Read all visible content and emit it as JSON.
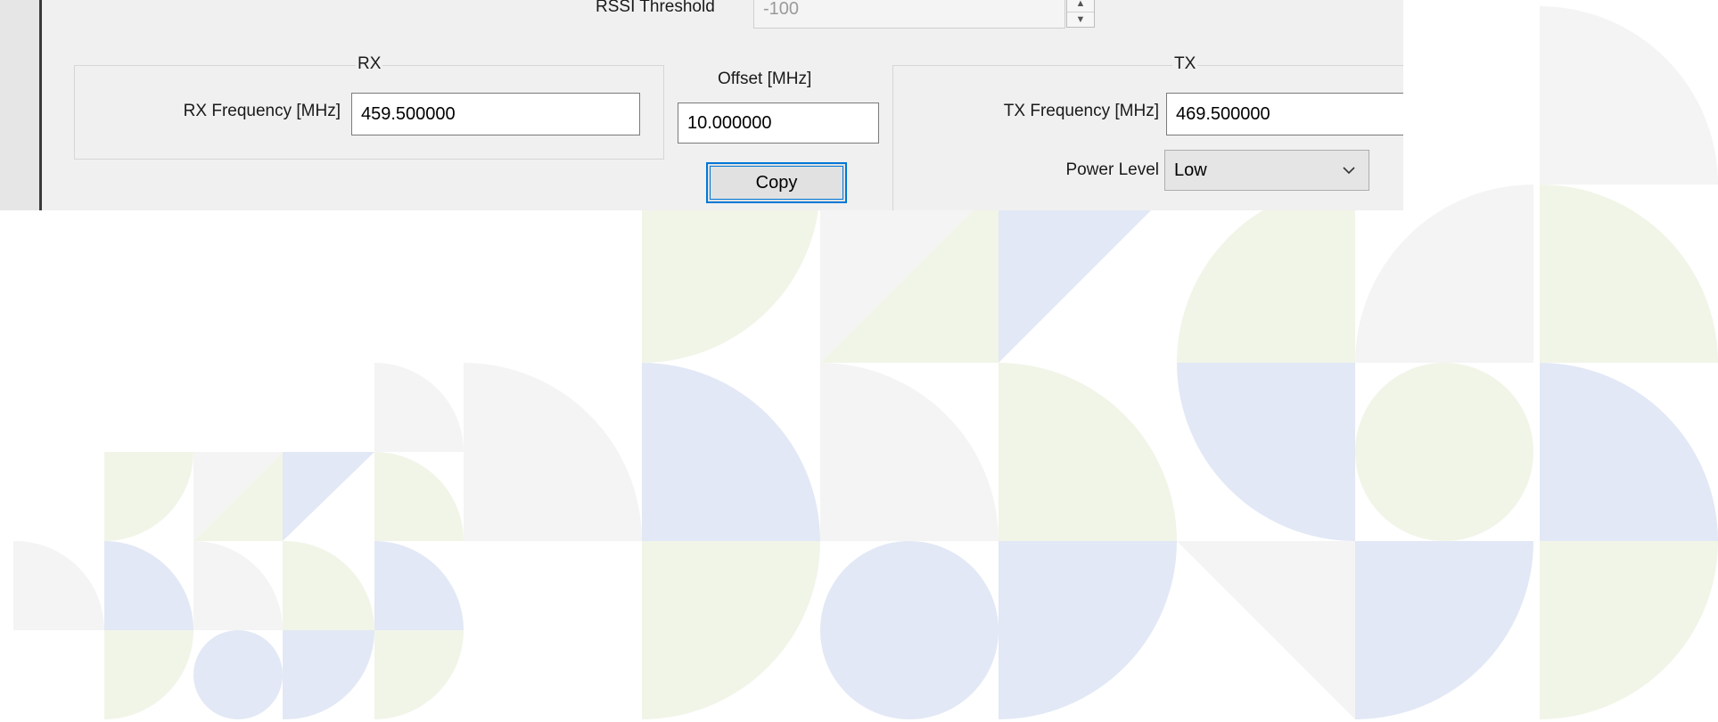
{
  "rssi": {
    "label": "RSSI Threshold",
    "value": "-100"
  },
  "rx": {
    "group_title": "RX",
    "frequency_label": "RX Frequency [MHz]",
    "frequency_value": "459.500000"
  },
  "offset": {
    "label": "Offset [MHz]",
    "value": "10.000000",
    "copy_label": "Copy"
  },
  "tx": {
    "group_title": "TX",
    "frequency_label": "TX Frequency [MHz]",
    "frequency_value": "469.500000",
    "power_label": "Power Level",
    "power_value": "Low"
  },
  "colors": {
    "background": "#ffffff",
    "pattern_grey": "#f4f4f4",
    "pattern_green": "#f1f5e8",
    "pattern_blue": "#e2e8f5",
    "focus_accent": "#0078d7"
  }
}
